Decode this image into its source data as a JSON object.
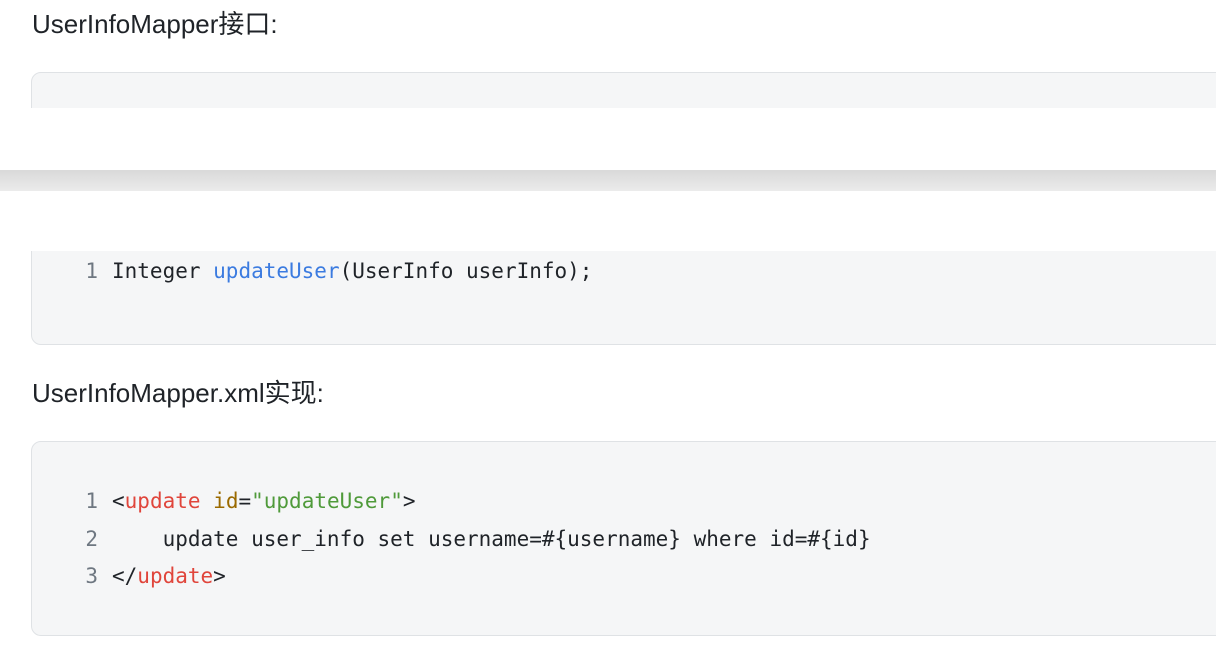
{
  "section1": {
    "heading": "UserInfoMapper接口:",
    "code": {
      "lines": [
        {
          "num": "1",
          "type": "Integer ",
          "method": "updateUser",
          "rest": "(UserInfo userInfo);"
        }
      ]
    }
  },
  "section2": {
    "heading": "UserInfoMapper.xml实现:",
    "code": {
      "lines": [
        {
          "num": "1",
          "lt": "<",
          "tag": "update",
          "sp": " ",
          "attr": "id",
          "eq": "=",
          "str": "\"updateUser\"",
          "gt": ">"
        },
        {
          "num": "2",
          "text": "    update user_info set username=#{username} where id=#{id}"
        },
        {
          "num": "3",
          "lt": "</",
          "tag": "update",
          "gt": ">"
        }
      ]
    }
  },
  "colors": {
    "code_background": "#f5f6f7",
    "method": "#3b7be0",
    "xml_tag": "#e0453b",
    "xml_attr": "#9a6a00",
    "xml_string": "#4f9a3a"
  }
}
